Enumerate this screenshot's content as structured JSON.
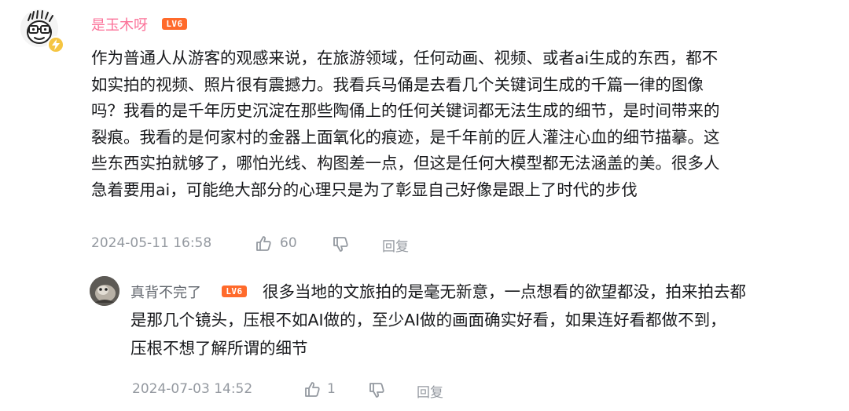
{
  "comment": {
    "username": "是玉木呀",
    "level": "LV6",
    "lines": [
      "作为普通人从游客的观感来说，在旅游领域，任何动画、视频、或者ai生成的东西，都不",
      "如实拍的视频、照片很有震撼力。我看兵马俑是去看几个关键词生成的千篇一律的图像",
      "吗？我看的是千年历史沉淀在那些陶俑上的任何关键词都无法生成的细节，是时间带来的",
      "裂痕。我看的是何家村的金器上面氧化的痕迹，是千年前的匠人灌注心血的细节描摹。这",
      "些东西实拍就够了，哪怕光线、构图差一点，但这是任何大模型都无法涵盖的美。很多人",
      "急着要用ai，可能绝大部分的心理只是为了彰显自己好像是跟上了时代的步伐"
    ],
    "timestamp": "2024-05-11 16:58",
    "likes": "60",
    "reply_label": "回复"
  },
  "reply": {
    "username": "真背不完了",
    "level": "LV6",
    "lines": [
      "很多当地的文旅拍的是毫无新意，一点想看的欲望都没，拍来拍去都",
      "是那几个镜头，压根不如AI做的，至少AI做的画面确实好看，如果连好看都做不到，",
      "压根不想了解所谓的细节"
    ],
    "timestamp": "2024-07-03 14:52",
    "likes": "1",
    "reply_label": "回复"
  },
  "colors": {
    "username_main": "#fb7299",
    "level_badge": "#ff6a2b",
    "meta_gray": "#9499a0",
    "text": "#18191c"
  },
  "icons": [
    "avatar-cartoon",
    "vip-lightning-icon",
    "thumbs-up-icon",
    "thumbs-down-icon",
    "avatar-photo"
  ]
}
